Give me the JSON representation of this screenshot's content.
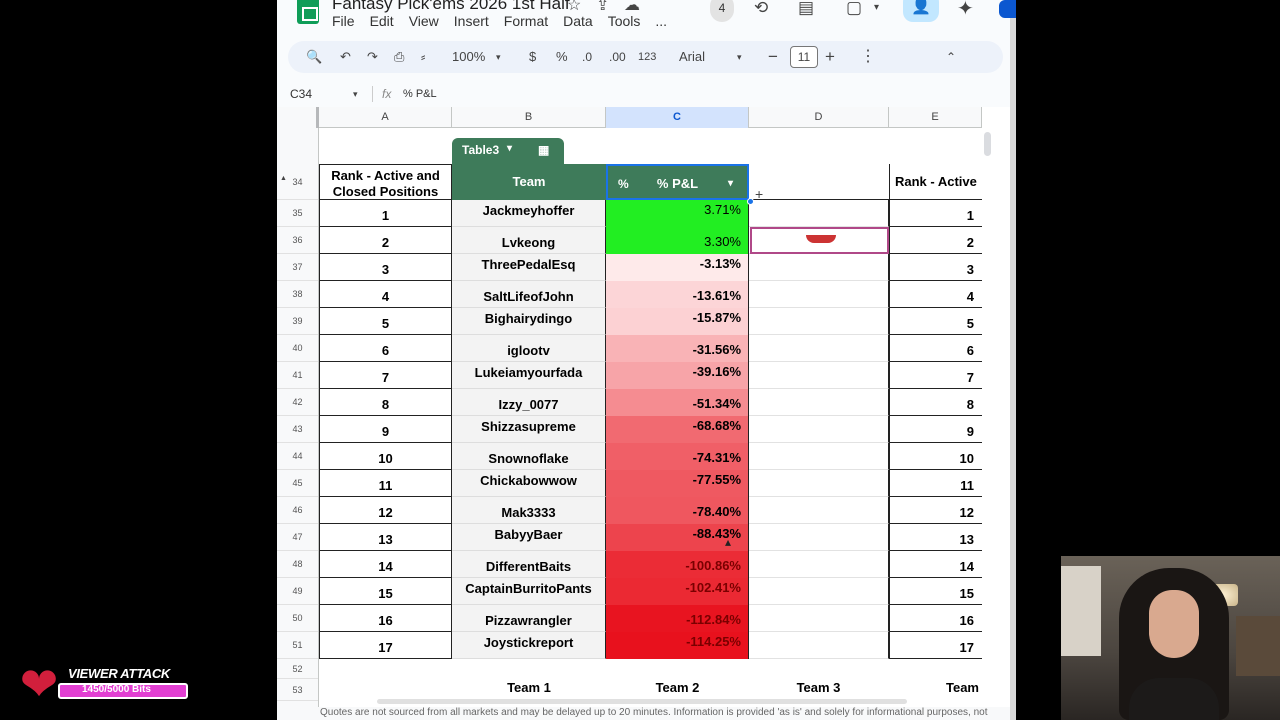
{
  "doc": {
    "title": "Fantasy Pick'ems 2026 1st Half",
    "menu": [
      "File",
      "Edit",
      "View",
      "Insert",
      "Format",
      "Data",
      "Tools",
      "..."
    ],
    "viewer_count": "4"
  },
  "icons": {
    "star": "☆",
    "move": "⇪",
    "cloud": "☁",
    "history": "⟲",
    "comment": "▤",
    "meet": "▢",
    "caret": "▾",
    "share": "👤",
    "gemini": "✦",
    "search": "🔍",
    "undo": "↶",
    "redo": "↷",
    "print": "⎙",
    "paint": "⸗",
    "more": "⋮",
    "collapse": "⌃",
    "fx": "fx",
    "plus": "+",
    "grid": "▦",
    "heart": "❤",
    "freeze": "▲"
  },
  "toolbar": {
    "zoom": "100%",
    "currency": "$",
    "percent": "%",
    "dec_decrease": ".0",
    "dec_increase": ".00",
    "more_formats": "123",
    "font": "Arial",
    "minus": "−",
    "font_size": "11",
    "plus": "+"
  },
  "formula": {
    "cell_ref": "C34",
    "value": "% P&L"
  },
  "columns": [
    "A",
    "B",
    "C",
    "D",
    "E"
  ],
  "table": {
    "name": "Table3",
    "headers": {
      "rank": "Rank - Active and Closed Positions",
      "team": "Team",
      "pl_type": "%",
      "pl": "% P&L",
      "e": "Rank - Active"
    },
    "rows": [
      {
        "row": "35",
        "rank": "1",
        "team": "Jackmeyhoffer",
        "pl": "3.71%",
        "e": "1"
      },
      {
        "row": "36",
        "rank": "2",
        "team": "Lvkeong",
        "pl": "3.30%",
        "e": "2"
      },
      {
        "row": "37",
        "rank": "3",
        "team": "ThreePedalEsq",
        "pl": "-3.13%",
        "e": "3"
      },
      {
        "row": "38",
        "rank": "4",
        "team": "SaltLifeofJohn",
        "pl": "-13.61%",
        "e": "4"
      },
      {
        "row": "39",
        "rank": "5",
        "team": "Bighairydingo",
        "pl": "-15.87%",
        "e": "5"
      },
      {
        "row": "40",
        "rank": "6",
        "team": "iglootv",
        "pl": "-31.56%",
        "e": "6"
      },
      {
        "row": "41",
        "rank": "7",
        "team": "Lukeiamyourfada",
        "pl": "-39.16%",
        "e": "7"
      },
      {
        "row": "42",
        "rank": "8",
        "team": "Izzy_0077",
        "pl": "-51.34%",
        "e": "8"
      },
      {
        "row": "43",
        "rank": "9",
        "team": "Shizzasupreme",
        "pl": "-68.68%",
        "e": "9"
      },
      {
        "row": "44",
        "rank": "10",
        "team": "Snownoflake",
        "pl": "-74.31%",
        "e": "10"
      },
      {
        "row": "45",
        "rank": "11",
        "team": "Chickabowwow",
        "pl": "-77.55%",
        "e": "11"
      },
      {
        "row": "46",
        "rank": "12",
        "team": "Mak3333",
        "pl": "-78.40%",
        "e": "12"
      },
      {
        "row": "47",
        "rank": "13",
        "team": "BabyyBaer",
        "pl": "-88.43%",
        "e": "13"
      },
      {
        "row": "48",
        "rank": "14",
        "team": "DifferentBaits",
        "pl": "-100.86%",
        "e": "14"
      },
      {
        "row": "49",
        "rank": "15",
        "team": "CaptainBurritoPants",
        "pl": "-102.41%",
        "e": "15"
      },
      {
        "row": "50",
        "rank": "16",
        "team": "Pizzawrangler",
        "pl": "-112.84%",
        "e": "16"
      },
      {
        "row": "51",
        "rank": "17",
        "team": "Joystickreport",
        "pl": "-114.25%",
        "e": "17"
      }
    ],
    "header_row": "34"
  },
  "extra_rows": [
    "52",
    "53"
  ],
  "footer_row": {
    "b": "Team 1",
    "c": "Team 2",
    "d": "Team 3",
    "e": "Team"
  },
  "disclaimer": "Quotes are not sourced from all markets and may be delayed up to 20 minutes. Information is provided 'as is' and solely for informational purposes, not",
  "overlay": {
    "title": "VIEWER ATTACK",
    "progress": "1450/5000 Bits"
  },
  "colors": {
    "table_header": "#3e7b5a",
    "selection": "#1a73e8",
    "positive": "#22ee22",
    "negative_max": "#e8101c"
  }
}
